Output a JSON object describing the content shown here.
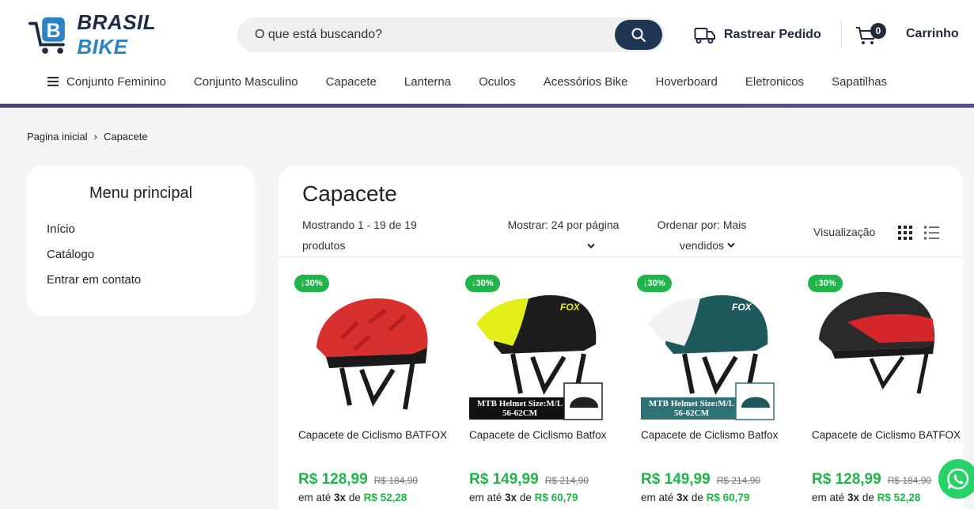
{
  "brand": {
    "name_part1": "BRASIL",
    "name_part2": "BIKE"
  },
  "search": {
    "placeholder": "O que está buscando?"
  },
  "header": {
    "track_label": "Rastrear Pedido",
    "cart_label": "Carrinho",
    "cart_count": "0"
  },
  "nav": {
    "items": [
      "Conjunto Feminino",
      "Conjunto Masculino",
      "Capacete",
      "Lanterna",
      "Oculos",
      "Acessórios Bike",
      "Hoverboard",
      "Eletronicos",
      "Sapatilhas"
    ]
  },
  "breadcrumb": {
    "home": "Pagina inicial",
    "current": "Capacete"
  },
  "sidebar": {
    "title": "Menu principal",
    "links": [
      "Início",
      "Catálogo",
      "Entrar em contato"
    ]
  },
  "main": {
    "title": "Capacete",
    "count_text": "Mostrando 1 - 19 de 19 produtos",
    "show_text": "Mostrar: 24 por página",
    "order_text": "Ordenar por: Mais vendidos",
    "view_label": "Visualização"
  },
  "products": [
    {
      "badge": "↓30%",
      "name": "Capacete de Ciclismo BATFOX",
      "price": "R$ 128,99",
      "old_price": "R$ 184,90",
      "install_prefix": "em até",
      "install_n": "3x",
      "install_de": "de",
      "install_value": "R$ 52,28",
      "colors": {
        "main": "#d8302f",
        "accent": "#b51f1f",
        "visor": "#d8302f"
      }
    },
    {
      "badge": "↓30%",
      "name": "Capacete de Ciclismo Batfox",
      "price": "R$ 149,99",
      "old_price": "R$ 214,90",
      "install_prefix": "em até",
      "install_n": "3x",
      "install_de": "de",
      "install_value": "R$ 60,79",
      "inset_text": "MTB Helmet Size:M/L 56-62CM",
      "colors": {
        "main": "#1c1c1c",
        "accent": "#222",
        "visor": "#e4ee18"
      }
    },
    {
      "badge": "↓30%",
      "name": "Capacete de Ciclismo Batfox",
      "price": "R$ 149,99",
      "old_price": "R$ 214,90",
      "install_prefix": "em até",
      "install_n": "3x",
      "install_de": "de",
      "install_value": "R$ 60,79",
      "inset_text": "MTB Helmet Size:M/L 56-62CM",
      "colors": {
        "main": "#1e5a5c",
        "accent": "#154546",
        "visor": "#f2f2f2"
      }
    },
    {
      "badge": "↓30%",
      "name": "Capacete de Ciclismo BATFOX",
      "price": "R$ 128,99",
      "old_price": "R$ 184,90",
      "install_prefix": "em até",
      "install_n": "3x",
      "install_de": "de",
      "install_value": "R$ 52,28",
      "colors": {
        "main": "#2a2a2a",
        "accent": "#d5262a",
        "visor": "#2a2a2a"
      }
    }
  ]
}
